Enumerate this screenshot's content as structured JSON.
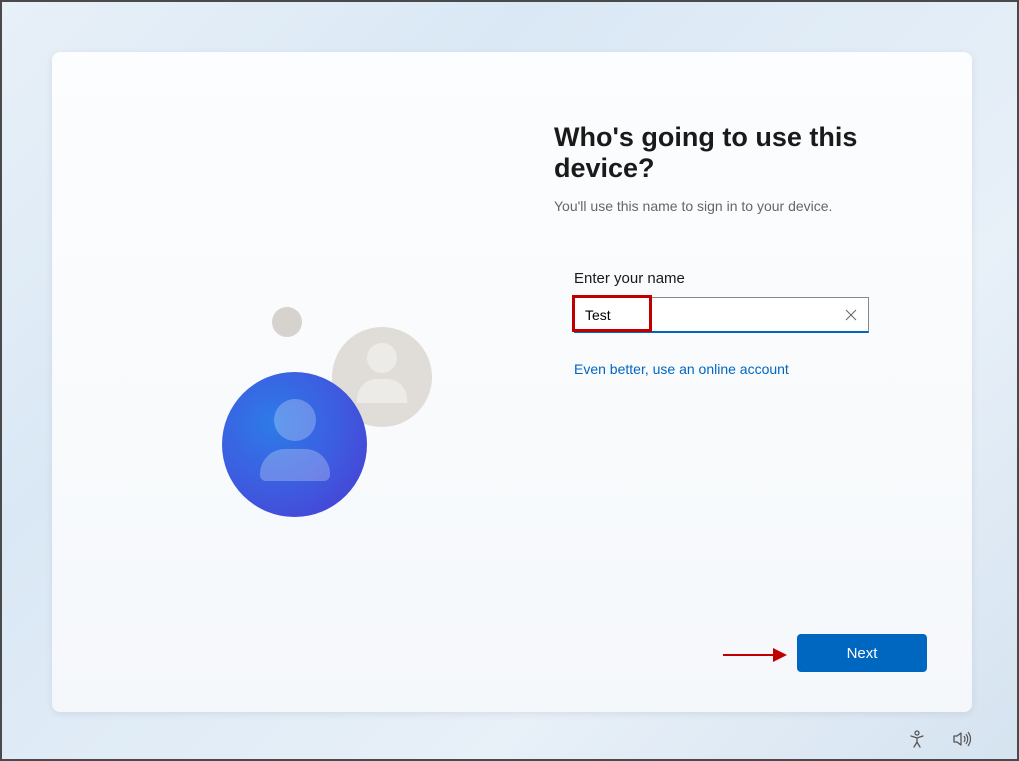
{
  "heading": "Who's going to use this device?",
  "subtitle": "You'll use this name to sign in to your device.",
  "form": {
    "label": "Enter your name",
    "value": "Test"
  },
  "online_link": "Even better, use an online account",
  "next_button": "Next",
  "colors": {
    "accent": "#0067c0",
    "annotation": "#c00000"
  }
}
